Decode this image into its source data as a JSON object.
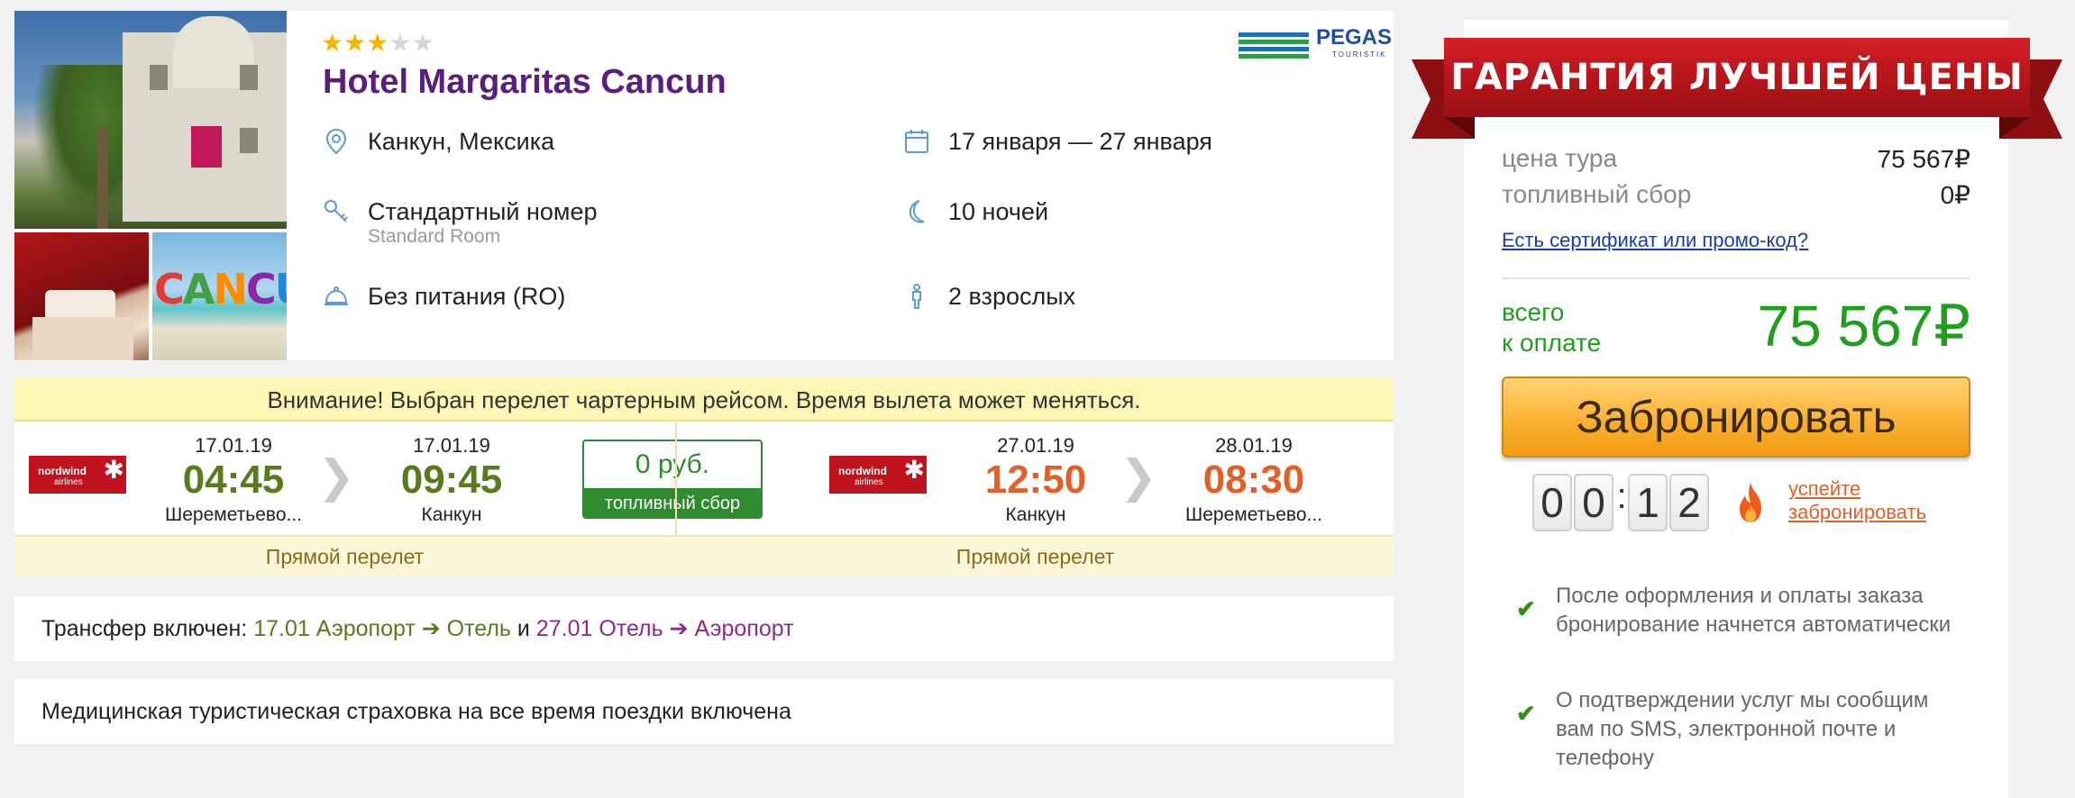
{
  "hotel": {
    "stars_filled": 3,
    "stars_total": 5,
    "name": "Hotel Margaritas Cancun",
    "operator_logo_text": "PEGAS",
    "operator_logo_sub": "TOURISTIK",
    "photo_caption": "CANCUN",
    "location": "Канкун, Мексика",
    "dates": "17 января — 27 января",
    "room": "Стандартный номер",
    "room_en": "Standard Room",
    "nights": "10 ночей",
    "meal": "Без питания (RO)",
    "guests": "2 взрослых"
  },
  "flight": {
    "warning": "Внимание! Выбран перелет чартерным рейсом. Время вылета может меняться.",
    "fuel_price": "0 руб.",
    "fuel_label": "топливный сбор",
    "outbound": {
      "airline_logo": "nordwind airlines",
      "dep_date": "17.01.19",
      "dep_time": "04:45",
      "dep_airport": "Шереметьево...",
      "arr_date": "17.01.19",
      "arr_time": "09:45",
      "arr_airport": "Канкун",
      "type": "Прямой перелет"
    },
    "return": {
      "airline_logo": "nordwind airlines",
      "dep_date": "27.01.19",
      "dep_time": "12:50",
      "dep_airport": "Канкун",
      "arr_date": "28.01.19",
      "arr_time": "08:30",
      "arr_airport": "Шереметьево...",
      "type": "Прямой перелет"
    }
  },
  "transfer": {
    "label": "Трансфер включен:",
    "out_date": "17.01",
    "out_from": "Аэропорт",
    "out_to": "Отель",
    "and": "и",
    "back_date": "27.01",
    "back_from": "Отель",
    "back_to": "Аэропорт"
  },
  "insurance": {
    "text": "Медицинская туристическая страховка на все время поездки включена"
  },
  "price_panel": {
    "banner": "ГАРАНТИЯ ЛУЧШЕЙ ЦЕНЫ",
    "tour_price_label": "цена тура",
    "tour_price_value": "75 567₽",
    "fuel_label": "топливный сбор",
    "fuel_value": "0₽",
    "promo_link": "Есть сертификат или промо-код?",
    "total_label_1": "всего",
    "total_label_2": "к оплате",
    "total_value": "75 567₽",
    "book_button": "Забронировать",
    "timer_digits": [
      "0",
      "0",
      "1",
      "2"
    ],
    "timer_separator": ":",
    "hurry_line_1": "успейте",
    "hurry_line_2": "забронировать",
    "notes": [
      "После оформления и оплаты заказа бронирование начнется автоматически",
      "О подтверждении услуг мы сообщим вам по SMS, электронной почте и телефону"
    ]
  },
  "colors": {
    "hotel_title": "#5b1e7f",
    "outbound_time": "#5a7a1e",
    "return_time": "#e1602a",
    "total": "#1f9e1f",
    "book_button": "#fbb43a",
    "banner": "#c41a20"
  },
  "icons": {
    "location": "location-pin-icon",
    "calendar": "calendar-icon",
    "room": "key-icon",
    "nights": "moon-icon",
    "meal": "cloche-icon",
    "guests": "person-icon",
    "chevron": "chevron-right-icon",
    "check": "check-icon",
    "fire": "fire-icon"
  }
}
